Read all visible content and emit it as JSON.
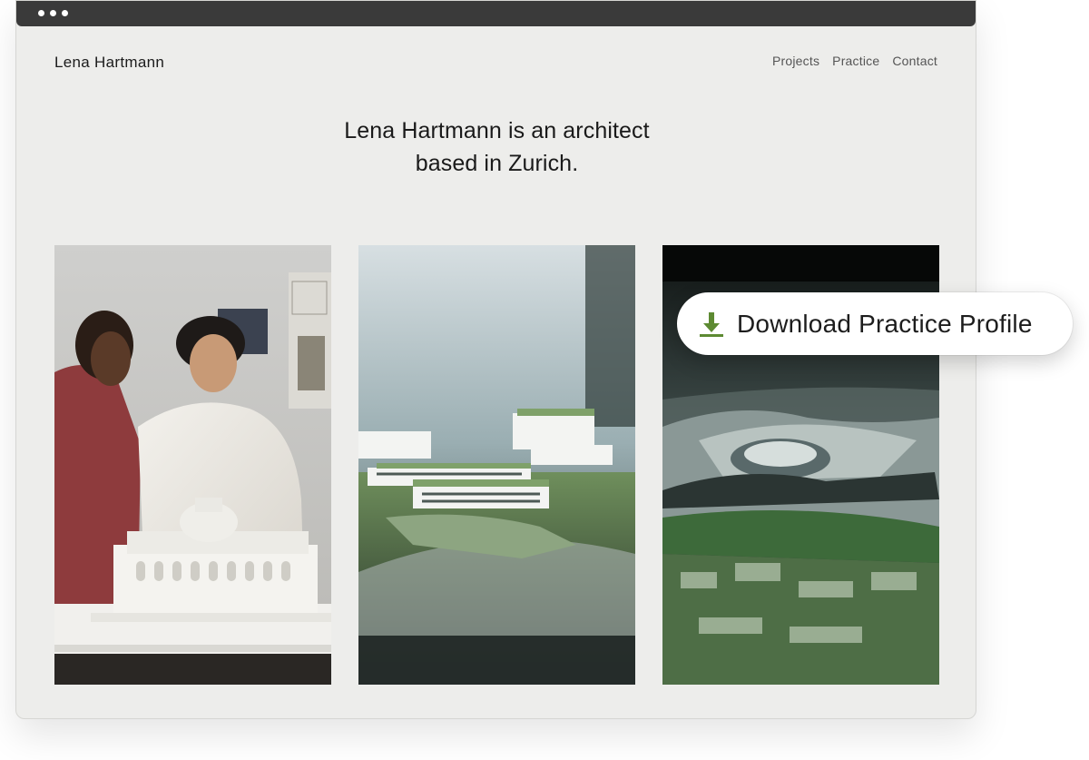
{
  "site": {
    "logo": "Lena Hartmann",
    "nav": [
      "Projects",
      "Practice",
      "Contact"
    ]
  },
  "hero": {
    "line1": "Lena Hartmann is an architect",
    "line2": "based in Zurich."
  },
  "photos": [
    {
      "subject": "two people examining white classical building model"
    },
    {
      "subject": "blurred white and green architectural site model"
    },
    {
      "subject": "dark metallic futuristic architectural model"
    }
  ],
  "cta": {
    "label": "Download Practice Profile",
    "icon": "download-icon",
    "accent": "#5d8a32"
  }
}
